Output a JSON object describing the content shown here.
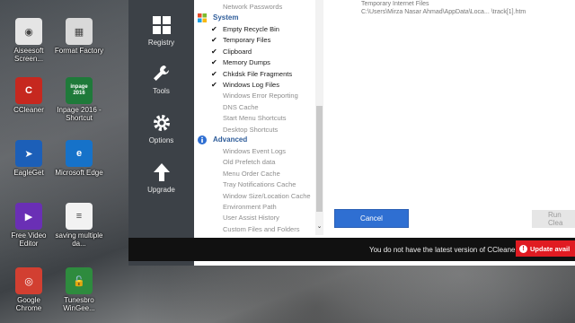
{
  "desktop": {
    "icons": [
      {
        "label": "Aiseesoft Screen...",
        "name": "aiseesoft-icon",
        "color": "#e5e5e5",
        "glyph": "◉"
      },
      {
        "label": "Format Factory",
        "name": "format-factory-icon",
        "color": "#d9d9d9",
        "glyph": "▦"
      },
      {
        "label": "CCleaner",
        "name": "ccleaner-icon",
        "color": "#c6281f",
        "glyph": "C"
      },
      {
        "label": "Inpage 2016 - Shortcut",
        "name": "inpage-icon",
        "color": "#1f7a3a",
        "glyph": "inpage\n2016"
      },
      {
        "label": "EagleGet",
        "name": "eagleget-icon",
        "color": "#1c5fb8",
        "glyph": "➤"
      },
      {
        "label": "Microsoft Edge",
        "name": "edge-icon",
        "color": "#1672c9",
        "glyph": "e"
      },
      {
        "label": "Free Video Editor",
        "name": "video-editor-icon",
        "color": "#6a2fb5",
        "glyph": "▶"
      },
      {
        "label": "saving multiple da...",
        "name": "document-icon",
        "color": "#f2f2f2",
        "glyph": "≡"
      },
      {
        "label": "Google Chrome",
        "name": "chrome-icon",
        "color": "#d23f31",
        "glyph": "◎"
      },
      {
        "label": "Tunesbro WinGee...",
        "name": "tunesbro-icon",
        "color": "#2e8b3e",
        "glyph": "🔓"
      }
    ]
  },
  "sidebar": {
    "items": [
      {
        "label": "Registry",
        "icon": "grid-icon"
      },
      {
        "label": "Tools",
        "icon": "wrench-icon"
      },
      {
        "label": "Options",
        "icon": "gear-icon"
      },
      {
        "label": "Upgrade",
        "icon": "arrow-up-icon"
      }
    ]
  },
  "list": {
    "top_row": "Network Passwords",
    "system_title": "System",
    "system_items": [
      {
        "label": "Empty Recycle Bin",
        "checked": true
      },
      {
        "label": "Temporary Files",
        "checked": true
      },
      {
        "label": "Clipboard",
        "checked": true
      },
      {
        "label": "Memory Dumps",
        "checked": true
      },
      {
        "label": "Chkdsk File Fragments",
        "checked": true
      },
      {
        "label": "Windows Log Files",
        "checked": true
      },
      {
        "label": "Windows Error Reporting",
        "checked": false
      },
      {
        "label": "DNS Cache",
        "checked": false
      },
      {
        "label": "Start Menu Shortcuts",
        "checked": false
      },
      {
        "label": "Desktop Shortcuts",
        "checked": false
      }
    ],
    "advanced_title": "Advanced",
    "advanced_items": [
      {
        "label": "Windows Event Logs",
        "checked": false
      },
      {
        "label": "Old Prefetch data",
        "checked": false
      },
      {
        "label": "Menu Order Cache",
        "checked": false
      },
      {
        "label": "Tray Notifications Cache",
        "checked": false
      },
      {
        "label": "Window Size/Location Cache",
        "checked": false
      },
      {
        "label": "Environment Path",
        "checked": false
      },
      {
        "label": "User Assist History",
        "checked": false
      },
      {
        "label": "Custom Files and Folders",
        "checked": false
      }
    ]
  },
  "results": {
    "line1": "Temporary Internet Files",
    "line2": "C:\\Users\\Mirza Nasar Ahmad\\AppData\\Loca...  \\track[1].htm"
  },
  "buttons": {
    "cancel": "Cancel",
    "run": "Run Clea"
  },
  "status": {
    "message": "You do not have the latest version of CCleaner",
    "update": "Update avail"
  },
  "colors": {
    "sidebar": "#3c4147",
    "accent": "#2f6fd2",
    "section": "#2f5d9a",
    "update": "#e01b22"
  }
}
